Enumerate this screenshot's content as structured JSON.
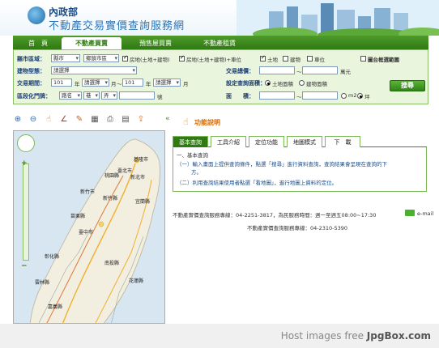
{
  "header": {
    "org": "內政部",
    "title": "不動產交易實價查詢服務網"
  },
  "nav": {
    "tabs": [
      "首　頁",
      "不動產買賣",
      "預售屋買賣",
      "不動產租賃"
    ]
  },
  "form": {
    "city_label": "縣市區域：",
    "city_value": "縣市",
    "district_value": "鄉鎮市區",
    "house_land": "房地(土地+建物)",
    "house_land_car": "房地(土地+建物)+車位",
    "land": "土地",
    "building": "建物",
    "parking": "車位",
    "whole_map": "圖台框選範圍",
    "type_label": "建物型態：",
    "type_value": "請選擇",
    "total_price_label": "交易總價：",
    "price_unit": "萬元",
    "period_label": "交易期間：",
    "year_from": "101",
    "year_unit": "年",
    "month_select": "請選擇",
    "month_unit": "月",
    "to": "～",
    "year_to": "101",
    "setting_label": "設定查詢面積：",
    "by_land_area": "土地面積",
    "by_building_area": "建物面積",
    "search_button": "搜尋",
    "door_label": "區段化門牌：",
    "road_value": "路名",
    "section_value": "巷",
    "alley_value": "弄",
    "number_unit": "號",
    "area_label": "面　　積：",
    "sqm": "m2",
    "ping": "坪"
  },
  "toolbar": {
    "icons": [
      "zoom-in-icon",
      "zoom-out-icon",
      "pan-icon",
      "measure-icon",
      "pin-icon",
      "list-icon",
      "print-icon",
      "layer-icon",
      "export-icon"
    ],
    "glyphs": [
      "⊕",
      "⊖",
      "☝",
      "∠",
      "✎",
      "▦",
      "⎙",
      "▤",
      "⇪"
    ]
  },
  "map": {
    "labels": [
      "基隆市",
      "臺北市",
      "新北市",
      "桃園縣",
      "新竹縣",
      "新竹市",
      "苗栗縣",
      "宜蘭縣",
      "臺中市",
      "南投縣",
      "花蓮縣",
      "彰化縣",
      "雲林縣",
      "嘉義縣"
    ],
    "zoom_plus": "+",
    "zoom_minus": "−"
  },
  "help": {
    "link": "功能說明",
    "collapse": "«"
  },
  "tabs": {
    "items": [
      "基本查詢",
      "工具介紹",
      "定位功能",
      "地圖模式",
      "下　載"
    ]
  },
  "panel": {
    "heading": "一、基本查詢",
    "step1": "（一）輸入畫面上提供查詢條件，點選「搜尋」進行資料查詢，查詢結果會呈現在查詢的下",
    "step1b": "方。",
    "step2": "（二）利用查詢結果使用者點選「看地圖」，進行地圖上資料的定位。"
  },
  "footer": {
    "line1": "不動產實價查詢服務專線：04-2251-3817，為民服務時間：週一至週五08:00~17:30",
    "email": "e-mail",
    "line2": "不動產實價查詢服務專線：04-2310-5390"
  },
  "watermark": {
    "prefix": "Host images free ",
    "brand": "JpgBox.com"
  }
}
